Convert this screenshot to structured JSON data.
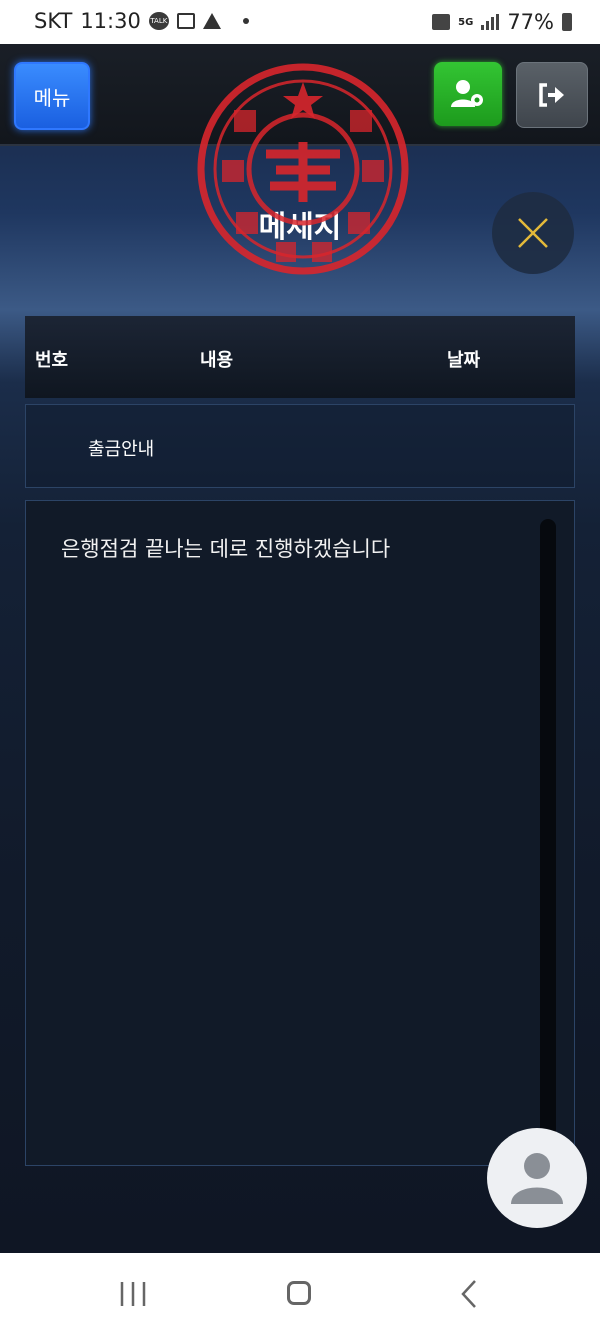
{
  "status_bar": {
    "carrier": "SKT",
    "time": "11:30",
    "talk_icon_text": "TALK",
    "network": "5G",
    "battery": "77%"
  },
  "header": {
    "menu_label": "메뉴"
  },
  "page": {
    "title": "메세지"
  },
  "table": {
    "headers": [
      "번호",
      "내용",
      "날짜"
    ],
    "rows": [
      {
        "number": "",
        "title": "출금안내",
        "date": ""
      }
    ]
  },
  "message": {
    "body": "은행점검 끝나는 데로 진행하겠습니다"
  },
  "colors": {
    "menu_button": "#1a5fe0",
    "user_button": "#1d9b1d",
    "stamp_red": "#d8262c",
    "close_accent": "#e3b93a"
  }
}
